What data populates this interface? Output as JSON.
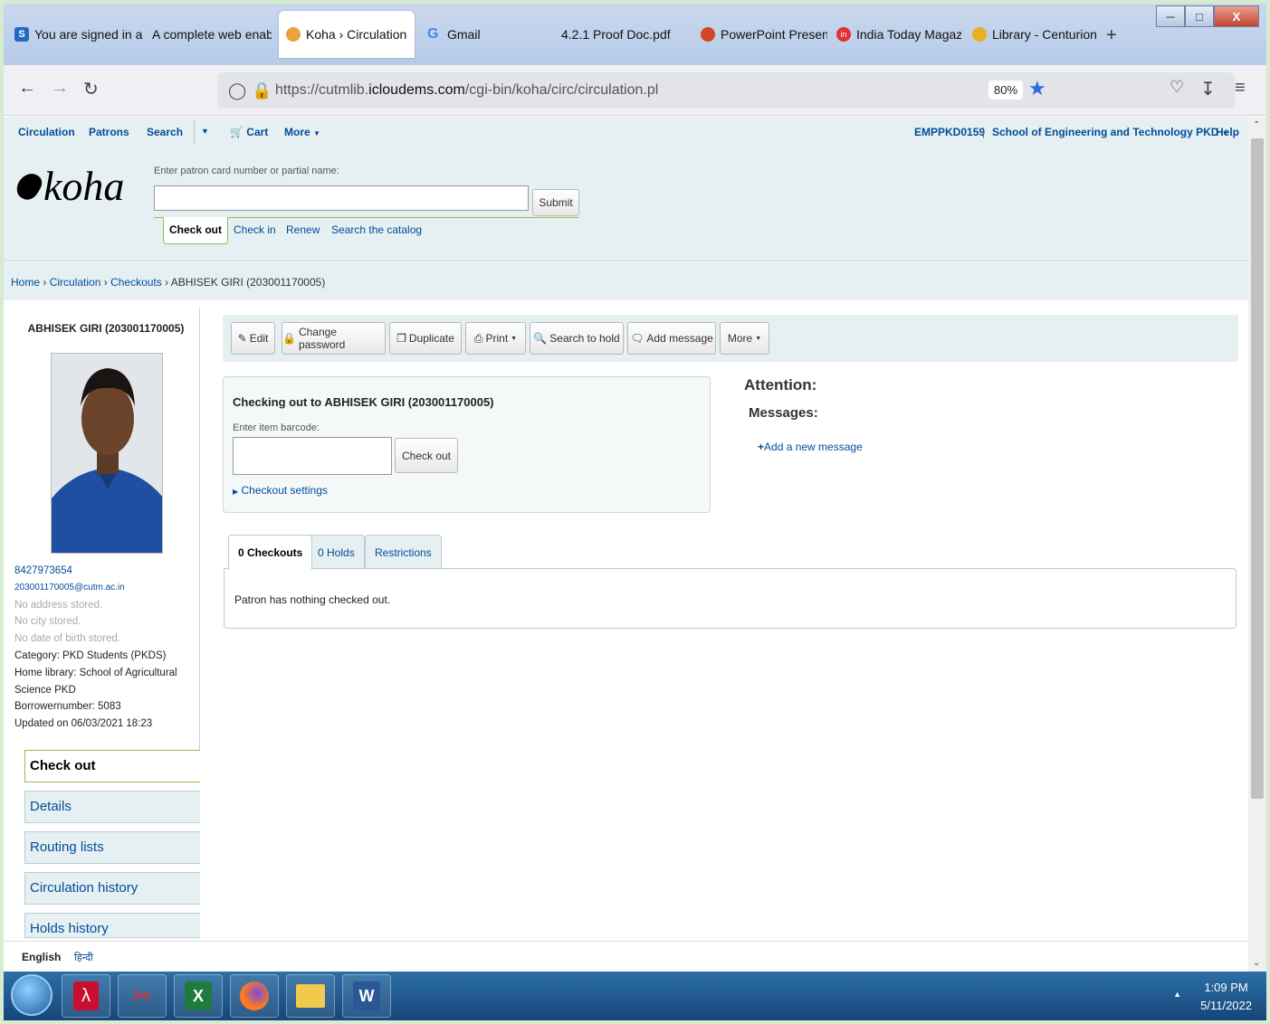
{
  "browser": {
    "tabs": [
      {
        "label": "You are signed in as",
        "favicon_color": "#2469c3",
        "favicon_letter": "S"
      },
      {
        "label": "A complete web enable",
        "favicon_color": ""
      },
      {
        "label": "Koha › Circulation",
        "favicon_color": "#e8a33a",
        "active": true
      },
      {
        "label": "Gmail",
        "favicon_color": "#4285f4",
        "favicon_letter": "G"
      },
      {
        "label": "4.2.1 Proof Doc.pdf",
        "favicon_color": ""
      },
      {
        "label": "PowerPoint Present",
        "favicon_color": "#d24726"
      },
      {
        "label": "India Today Magazi",
        "favicon_color": "#e03030",
        "favicon_letter": "in"
      },
      {
        "label": "Library - Centurion",
        "favicon_color": "#e9b020"
      }
    ],
    "close_tab_glyph": "X",
    "new_tab_glyph": "+",
    "url_prefix": "https://cutmlib.",
    "url_host": "icloudems.com",
    "url_suffix": "/cgi-bin/koha/circ/circulation.pl",
    "zoom": "80%"
  },
  "koha": {
    "topnav": {
      "circulation": "Circulation",
      "patrons": "Patrons",
      "search": "Search",
      "cart": "Cart",
      "more": "More",
      "user": "EMPPKD0159",
      "separator": "|",
      "library": "School of Engineering and Technology PKD",
      "help": "Help"
    },
    "logo_text": "koha",
    "search_label": "Enter patron card number or partial name:",
    "submit": "Submit",
    "subtabs": {
      "check_out": "Check out",
      "check_in": "Check in",
      "renew": "Renew",
      "search_catalog": "Search the catalog"
    },
    "breadcrumb": {
      "home": "Home",
      "circulation": "Circulation",
      "checkouts": "Checkouts",
      "patron": "ABHISEK GIRI (203001170005)",
      "sep": " › "
    }
  },
  "patron": {
    "name": "ABHISEK GIRI (203001170005)",
    "phone": "8427973654",
    "email": "203001170005@cutm.ac.in",
    "no_address": "No address stored.",
    "no_city": "No city stored.",
    "no_dob": "No date of birth stored.",
    "category": "Category: PKD Students (PKDS)",
    "home_library": "Home library: School of Agricultural Science PKD",
    "borrowernumber": "Borrowernumber: 5083",
    "updated": "Updated on 06/03/2021 18:23"
  },
  "side_nav": [
    "Check out",
    "Details",
    "Routing lists",
    "Circulation history",
    "Holds history"
  ],
  "toolbar": {
    "edit": "Edit",
    "change_password": "Change password",
    "duplicate": "Duplicate",
    "print": "Print",
    "search_to_hold": "Search to hold",
    "add_message": "Add message",
    "more": "More"
  },
  "checkout": {
    "title": "Checking out to ABHISEK GIRI (203001170005)",
    "barcode_label": "Enter item barcode:",
    "button": "Check out",
    "settings": "Checkout settings"
  },
  "attention": "Attention:",
  "messages": "Messages:",
  "add_new_message": "Add a new message",
  "patron_tabs": [
    "0 Checkouts",
    "0 Holds",
    "Restrictions"
  ],
  "nothing_checked_out": "Patron has nothing checked out.",
  "languages": [
    "English",
    "हिन्दी"
  ],
  "taskbar": {
    "time": "1:09 PM",
    "date": "5/11/2022"
  },
  "colors": {
    "link": "#004d99",
    "header_bg": "#e6f0f2",
    "active_green": "#8cc24a"
  }
}
